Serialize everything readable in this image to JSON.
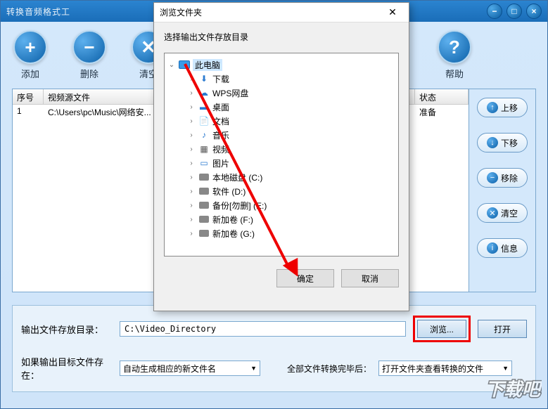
{
  "titlebar": {
    "title": "转换音频格式工",
    "minimize": "−",
    "maximize": "□",
    "close": "×"
  },
  "toolbar": {
    "add": "添加",
    "delete": "删除",
    "clear": "清空",
    "help": "帮助"
  },
  "table": {
    "headers": {
      "seq": "序号",
      "source": "视频源文件",
      "status": "状态"
    },
    "rows": [
      {
        "seq": "1",
        "source": "C:\\Users\\pc\\Music\\网络安...",
        "status": "准备"
      }
    ]
  },
  "side": {
    "up": "上移",
    "down": "下移",
    "remove": "移除",
    "clear": "清空",
    "info": "信息"
  },
  "bottom": {
    "output_label": "输出文件存放目录：",
    "output_path": "C:\\Video_Directory",
    "browse": "浏览...",
    "open": "打开",
    "exist_label": "如果输出目标文件存在：",
    "exist_option": "自动生成相应的新文件名",
    "after_label": "全部文件转换完毕后：",
    "after_option": "打开文件夹查看转换的文件"
  },
  "dialog": {
    "title": "浏览文件夹",
    "subtitle": "选择输出文件存放目录",
    "tree": [
      {
        "label": "此电脑",
        "root": true,
        "expanded": true,
        "icon": "monitor"
      },
      {
        "label": "下载",
        "icon": "download"
      },
      {
        "label": "WPS网盘",
        "icon": "cloud"
      },
      {
        "label": "桌面",
        "icon": "desktop"
      },
      {
        "label": "文档",
        "icon": "doc"
      },
      {
        "label": "音乐",
        "icon": "music"
      },
      {
        "label": "视频",
        "icon": "video"
      },
      {
        "label": "图片",
        "icon": "pic"
      },
      {
        "label": "本地磁盘 (C:)",
        "icon": "disk"
      },
      {
        "label": "软件 (D:)",
        "icon": "disk",
        "highlight": true
      },
      {
        "label": "备份[勿删] (E:)",
        "icon": "disk"
      },
      {
        "label": "新加卷 (F:)",
        "icon": "disk"
      },
      {
        "label": "新加卷 (G:)",
        "icon": "disk"
      }
    ],
    "ok": "确定",
    "cancel": "取消"
  },
  "watermark": "下载吧"
}
